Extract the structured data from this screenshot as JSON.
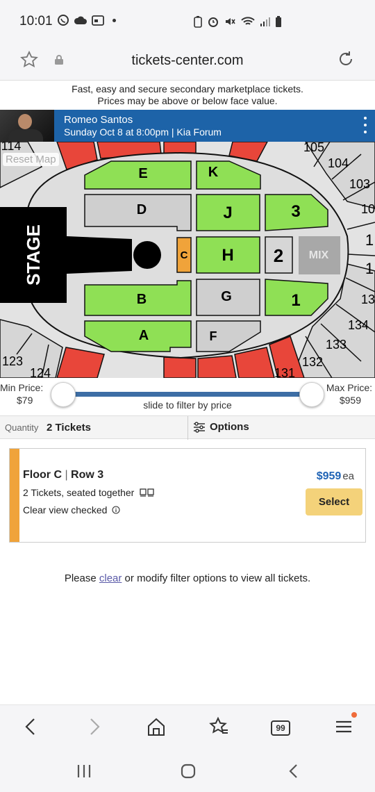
{
  "status_bar": {
    "time": "10:01"
  },
  "browser": {
    "domain": "tickets-center.com"
  },
  "banner": {
    "line1": "Fast, easy and secure secondary marketplace tickets.",
    "line2": "Prices may be above or below face value."
  },
  "event": {
    "performer": "Romeo Santos",
    "datetime_venue": "Sunday Oct 8 at 8:00pm | Kia Forum"
  },
  "map": {
    "reset_label": "Reset Map",
    "stage_label": "STAGE",
    "mix_label": "MIX",
    "floor_sections": {
      "e": "E",
      "k": "K",
      "d": "D",
      "j": "J",
      "s3": "3",
      "c": "C",
      "h": "H",
      "s2": "2",
      "b": "B",
      "g": "G",
      "s1": "1",
      "a": "A",
      "f": "F"
    },
    "outer_sections": {
      "s114": "114",
      "s105": "105",
      "s104": "104",
      "s103": "103",
      "s102": "10",
      "s101": "1",
      "s136": "1",
      "s135": "13",
      "s134": "134",
      "s133": "133",
      "s132": "132",
      "s131": "131",
      "s123": "123",
      "s124": "124"
    },
    "colors": {
      "available": "#8fe055",
      "selected": "#f0a33a",
      "unavailable": "#cfcfcf",
      "premium": "#e8463a",
      "stage": "#000000",
      "mix": "#a8a8a8"
    }
  },
  "price_filter": {
    "min_label": "Min Price:",
    "min_value": "$79",
    "max_label": "Max Price:",
    "max_value": "$959",
    "hint": "slide to filter by price"
  },
  "quantity_bar": {
    "label": "Quantity",
    "value": "2 Tickets",
    "options_label": "Options"
  },
  "listing": {
    "section": "Floor C",
    "row": "Row 3",
    "seated": "2 Tickets, seated together",
    "clear_view": "Clear view checked",
    "price": "$959",
    "price_unit": "ea",
    "select_label": "Select"
  },
  "notice": {
    "prefix": "Please ",
    "link": "clear",
    "suffix": " or modify filter options to view all tickets."
  },
  "bottom_nav": {
    "tabs_count": "99"
  }
}
